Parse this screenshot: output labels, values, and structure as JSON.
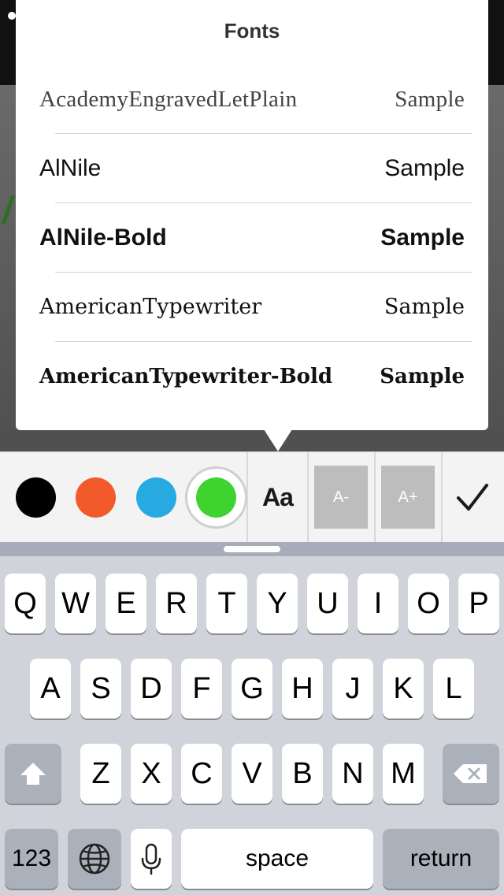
{
  "popover": {
    "title": "Fonts",
    "fonts": [
      {
        "name": "AcademyEngravedLetPlain",
        "sample": "Sample"
      },
      {
        "name": "AlNile",
        "sample": "Sample"
      },
      {
        "name": "AlNile-Bold",
        "sample": "Sample"
      },
      {
        "name": "AmericanTypewriter",
        "sample": "Sample"
      },
      {
        "name": "AmericanTypewriter-Bold",
        "sample": "Sample"
      }
    ]
  },
  "toolbar": {
    "colors": [
      "#000000",
      "#f25a2b",
      "#27a9e2",
      "#3fd32f"
    ],
    "selected_color_index": 3,
    "font_button": "Aa",
    "decrease_size": "A-",
    "increase_size": "A+"
  },
  "keyboard": {
    "row1": [
      "Q",
      "W",
      "E",
      "R",
      "T",
      "Y",
      "U",
      "I",
      "O",
      "P"
    ],
    "row2": [
      "A",
      "S",
      "D",
      "F",
      "G",
      "H",
      "J",
      "K",
      "L"
    ],
    "row3": [
      "Z",
      "X",
      "C",
      "V",
      "B",
      "N",
      "M"
    ],
    "numbers_key": "123",
    "space_key": "space",
    "return_key": "return"
  }
}
